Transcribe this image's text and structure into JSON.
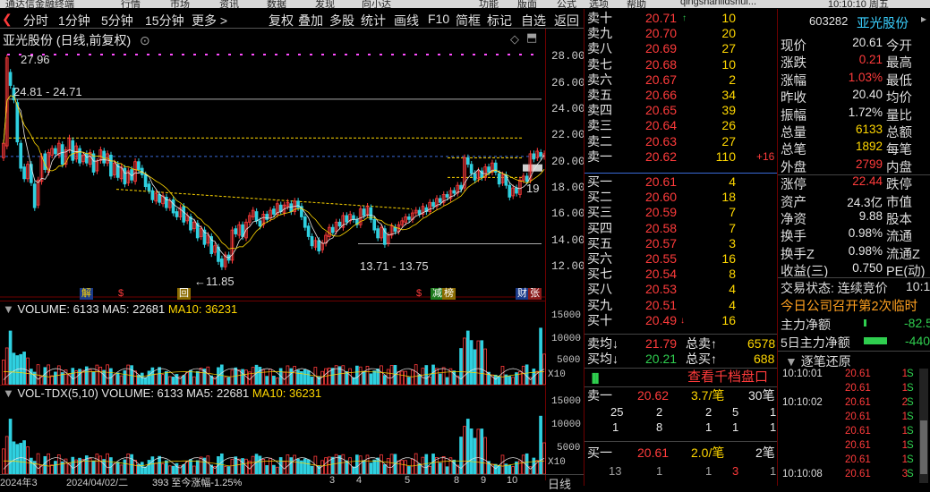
{
  "titlebar": {
    "app": "通达信金融终端",
    "menus": [
      "行情",
      "市场",
      "资讯",
      "数据",
      "发现",
      "向小达",
      "功能",
      "版面",
      "公式",
      "选项",
      "帮助"
    ],
    "pinyin": "qingshanlidshui...",
    "clock": "10:10:10 周五"
  },
  "toolbar": {
    "left": [
      "分时",
      "1分钟",
      "5分钟",
      "15分钟",
      "更多 >"
    ],
    "right": [
      "复权",
      "叠加",
      "多股",
      "统计",
      "画线",
      "F10",
      "简框",
      "标记",
      "自选",
      "返回"
    ]
  },
  "chart": {
    "title": "亚光股份 (日线,前复权)",
    "price_labels": [
      "27.96",
      "24.81 - 24.71",
      "13.71 - 13.75",
      "←11.85",
      "19"
    ],
    "y_ticks": [
      "28.00",
      "26.00",
      "24.00",
      "22.00",
      "20.00",
      "18.00",
      "16.00",
      "14.00",
      "12.00"
    ],
    "markers": [
      "解",
      "$",
      "回",
      "$",
      "减",
      "榜",
      "财",
      "张"
    ],
    "candles": [
      [
        20.3,
        21.4
      ],
      [
        21.2,
        27.9
      ],
      [
        26.8,
        25.8
      ],
      [
        25.6,
        24.7
      ],
      [
        24.5,
        21.5
      ],
      [
        21.4,
        19.5
      ],
      [
        19.6,
        18.7
      ],
      [
        18.7,
        19.8
      ],
      [
        19.8,
        18.4
      ],
      [
        18.3,
        16.5
      ],
      [
        16.7,
        18.6
      ],
      [
        18.5,
        20.4
      ],
      [
        20.6,
        19.4
      ],
      [
        19.2,
        20.7
      ],
      [
        20.5,
        21.0
      ],
      [
        21.0,
        20.6
      ],
      [
        20.5,
        21.4
      ],
      [
        21.3,
        19.8
      ],
      [
        19.8,
        20.9
      ],
      [
        20.9,
        21.8
      ],
      [
        21.6,
        20.1
      ],
      [
        20.2,
        21.2
      ],
      [
        21.0,
        19.9
      ],
      [
        20.0,
        20.5
      ],
      [
        20.6,
        19.9
      ],
      [
        19.8,
        20.7
      ],
      [
        20.6,
        19.2
      ],
      [
        19.3,
        20.0
      ],
      [
        20.1,
        20.9
      ],
      [
        20.8,
        19.9
      ],
      [
        19.9,
        20.6
      ],
      [
        20.5,
        18.9
      ],
      [
        19.0,
        19.9
      ],
      [
        19.8,
        18.8
      ],
      [
        18.7,
        19.6
      ],
      [
        19.5,
        18.3
      ],
      [
        18.4,
        19.3
      ],
      [
        19.4,
        18.6
      ],
      [
        18.5,
        20.0
      ],
      [
        20.0,
        19.4
      ],
      [
        19.5,
        19.0
      ],
      [
        19.0,
        18.1
      ],
      [
        18.3,
        17.8
      ],
      [
        17.8,
        17.1
      ],
      [
        17.0,
        17.6
      ],
      [
        17.5,
        16.9
      ],
      [
        16.8,
        17.4
      ],
      [
        17.3,
        16.5
      ],
      [
        16.5,
        17.0
      ],
      [
        17.1,
        16.1
      ],
      [
        16.2,
        15.8
      ],
      [
        15.8,
        16.5
      ],
      [
        16.6,
        15.4
      ],
      [
        15.5,
        15.9
      ],
      [
        15.8,
        14.8
      ],
      [
        14.9,
        15.4
      ],
      [
        15.3,
        14.2
      ],
      [
        14.3,
        14.9
      ],
      [
        14.8,
        13.7
      ],
      [
        13.8,
        14.4
      ],
      [
        14.3,
        13.0
      ],
      [
        13.1,
        13.6
      ],
      [
        13.5,
        12.4
      ],
      [
        12.6,
        12.0
      ],
      [
        12.0,
        12.9
      ],
      [
        12.9,
        12.5
      ],
      [
        12.5,
        14.8
      ],
      [
        14.9,
        14.5
      ],
      [
        14.4,
        15.2
      ],
      [
        15.2,
        14.3
      ],
      [
        14.2,
        15.4
      ],
      [
        15.4,
        15.9
      ],
      [
        15.8,
        16.3
      ],
      [
        16.2,
        15.5
      ],
      [
        15.5,
        15.1
      ],
      [
        15.2,
        16.0
      ],
      [
        16.0,
        15.6
      ],
      [
        15.7,
        16.3
      ],
      [
        16.4,
        16.0
      ],
      [
        16.0,
        16.8
      ],
      [
        16.7,
        16.2
      ],
      [
        16.1,
        16.7
      ],
      [
        16.6,
        16.9
      ],
      [
        16.8,
        16.2
      ],
      [
        16.2,
        17.0
      ],
      [
        17.0,
        16.5
      ],
      [
        16.6,
        15.8
      ],
      [
        15.8,
        15.0
      ],
      [
        15.1,
        14.3
      ],
      [
        14.3,
        13.6
      ],
      [
        13.5,
        14.0
      ],
      [
        14.0,
        13.2
      ],
      [
        13.3,
        13.8
      ],
      [
        13.8,
        14.4
      ],
      [
        14.3,
        15.0
      ],
      [
        15.0,
        14.6
      ],
      [
        14.7,
        15.4
      ],
      [
        15.4,
        15.1
      ],
      [
        15.0,
        15.9
      ],
      [
        15.9,
        15.4
      ],
      [
        15.5,
        16.0
      ],
      [
        15.9,
        15.6
      ],
      [
        15.6,
        15.2
      ],
      [
        15.2,
        16.4
      ],
      [
        16.4,
        15.9
      ],
      [
        16.0,
        16.6
      ],
      [
        16.5,
        15.6
      ],
      [
        15.6,
        14.8
      ],
      [
        14.9,
        14.2
      ],
      [
        14.2,
        15.0
      ],
      [
        14.9,
        13.7
      ],
      [
        13.8,
        14.4
      ],
      [
        14.4,
        15.1
      ],
      [
        15.0,
        14.7
      ],
      [
        14.7,
        15.2
      ],
      [
        15.2,
        15.5
      ],
      [
        15.4,
        15.8
      ],
      [
        15.8,
        15.6
      ],
      [
        15.6,
        16.1
      ],
      [
        16.1,
        16.3
      ],
      [
        16.3,
        16.0
      ],
      [
        16.0,
        16.6
      ],
      [
        16.5,
        16.2
      ],
      [
        16.2,
        16.9
      ],
      [
        16.9,
        16.6
      ],
      [
        16.6,
        17.2
      ],
      [
        17.2,
        16.9
      ],
      [
        16.9,
        17.5
      ],
      [
        17.5,
        17.3
      ],
      [
        17.2,
        17.8
      ],
      [
        17.8,
        17.6
      ],
      [
        17.6,
        18.2
      ],
      [
        18.2,
        17.9
      ],
      [
        18.0,
        20.3
      ],
      [
        20.3,
        19.8
      ],
      [
        19.8,
        19.1
      ],
      [
        19.1,
        18.6
      ],
      [
        18.7,
        19.3
      ],
      [
        19.3,
        18.8
      ],
      [
        18.8,
        19.6
      ],
      [
        19.6,
        19.2
      ],
      [
        19.2,
        19.9
      ],
      [
        19.9,
        19.2
      ],
      [
        19.1,
        18.3
      ],
      [
        18.4,
        19.0
      ],
      [
        19.0,
        18.2
      ],
      [
        18.2,
        17.3
      ],
      [
        17.4,
        18.0
      ],
      [
        18.0,
        17.6
      ],
      [
        17.5,
        18.6
      ],
      [
        18.6,
        18.9
      ],
      [
        18.9,
        18.5
      ],
      [
        18.6,
        20.6
      ],
      [
        20.6,
        20.2
      ],
      [
        20.3,
        20.8
      ],
      [
        20.7,
        20.4
      ],
      [
        20.4,
        20.6
      ]
    ]
  },
  "volume": {
    "label": "VOLUME: 6133 MA5: 22681",
    "ma10": "MA10: 36231",
    "ticks": [
      "15000",
      "10000",
      "5000",
      "X10"
    ]
  },
  "voltdx": {
    "label": "VOL-TDX(5,10) VOLUME: 6133 MA5: 22681",
    "ma10": "MA10: 36231",
    "ticks": [
      "15000",
      "10000",
      "5000",
      "X10"
    ]
  },
  "xaxis": {
    "labels": [
      "2024年3",
      "2024/04/02/二",
      "393 至今涨幅-1.25%",
      "3",
      "4",
      "5",
      "8",
      "9",
      "10",
      "日线"
    ]
  },
  "orderbook": {
    "asks": [
      [
        "卖十",
        "20.71",
        "10"
      ],
      [
        "卖九",
        "20.70",
        "20"
      ],
      [
        "卖八",
        "20.69",
        "27"
      ],
      [
        "卖七",
        "20.68",
        "10"
      ],
      [
        "卖六",
        "20.67",
        "2"
      ],
      [
        "卖五",
        "20.66",
        "34"
      ],
      [
        "卖四",
        "20.65",
        "39"
      ],
      [
        "卖三",
        "20.64",
        "26"
      ],
      [
        "卖二",
        "20.63",
        "27"
      ],
      [
        "卖一",
        "20.62",
        "110",
        "+16"
      ]
    ],
    "bids": [
      [
        "买一",
        "20.61",
        "4"
      ],
      [
        "买二",
        "20.60",
        "18"
      ],
      [
        "买三",
        "20.59",
        "7"
      ],
      [
        "买四",
        "20.58",
        "7"
      ],
      [
        "买五",
        "20.57",
        "3"
      ],
      [
        "买六",
        "20.55",
        "16"
      ],
      [
        "买七",
        "20.54",
        "8"
      ],
      [
        "买八",
        "20.53",
        "4"
      ],
      [
        "买九",
        "20.51",
        "4"
      ],
      [
        "买十",
        "20.49",
        "16"
      ]
    ],
    "avg_ask": [
      "卖均",
      "21.79",
      "总卖",
      "6578"
    ],
    "avg_bid": [
      "买均",
      "20.21",
      "总买",
      "688"
    ],
    "link": "查看千档盘口",
    "queue_ask": [
      "卖一",
      "20.62",
      "3.7/笔",
      "30笔"
    ],
    "queue_ask_nums": [
      "25",
      "2",
      "2",
      "5",
      "1",
      "1",
      "8",
      "1",
      "1",
      "1"
    ],
    "queue_bid": [
      "买一",
      "20.61",
      "2.0/笔",
      "2笔"
    ],
    "queue_bid_nums": [
      "13",
      "1",
      "1",
      "3",
      "1"
    ]
  },
  "quote": {
    "code": "603282",
    "name": "亚光股份",
    "rows": [
      [
        "现价",
        "20.61",
        "今开"
      ],
      [
        "涨跌",
        "0.21",
        "最高"
      ],
      [
        "涨幅",
        "1.03%",
        "最低"
      ],
      [
        "昨收",
        "20.40",
        "均价"
      ],
      [
        "振幅",
        "1.72%",
        "量比"
      ],
      [
        "总量",
        "6133",
        "总额"
      ],
      [
        "总笔",
        "1892",
        "每笔"
      ],
      [
        "外盘",
        "2799",
        "内盘"
      ],
      [
        "涨停",
        "22.44",
        "跌停"
      ],
      [
        "资产",
        "24.3亿",
        "市值"
      ],
      [
        "净资",
        "9.88",
        "股本"
      ],
      [
        "换手",
        "0.98%",
        "流通"
      ],
      [
        "换手Z",
        "0.98%",
        "流通Z"
      ],
      [
        "收益(三)",
        "0.750",
        "PE(动)"
      ]
    ],
    "status": "交易状态: 连续竞价",
    "status_time": "10:1",
    "notice": "今日公司召开第2次临时",
    "net1": "主力净额",
    "net1v": "-82.5",
    "net2": "5日主力净额",
    "net2v": "-440.",
    "ticks_title": "逐笔还原",
    "ticks": [
      [
        "10:10:01",
        "20.61",
        "1",
        "S"
      ],
      [
        "",
        "20.61",
        "1",
        "S"
      ],
      [
        "10:10:02",
        "20.61",
        "2",
        "S"
      ],
      [
        "",
        "20.61",
        "1",
        "S"
      ],
      [
        "",
        "20.61",
        "1",
        "S"
      ],
      [
        "",
        "20.61",
        "1",
        "S"
      ],
      [
        "",
        "20.61",
        "1",
        "S"
      ],
      [
        "10:10:08",
        "20.61",
        "3",
        "S"
      ]
    ]
  }
}
